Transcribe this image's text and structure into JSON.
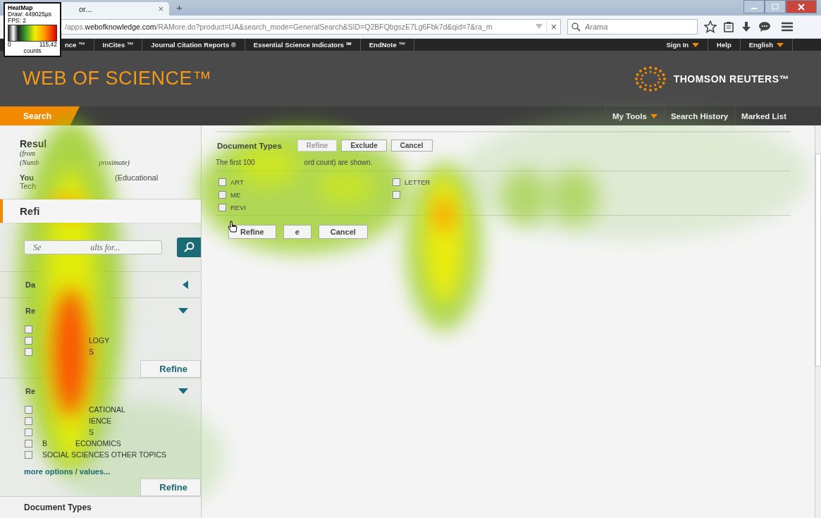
{
  "heatmap_legend": {
    "title": "HeatMap",
    "draw": "Draw: 449025µs",
    "fps": "FPS: 2",
    "min": "0",
    "max": "115,42",
    "unit": "counts"
  },
  "browser": {
    "tab": {
      "title": "or...",
      "close": "×"
    },
    "new_tab": "+",
    "url": "/apps.**webofknowledge.com**/RAMore.do?product=UA&search_mode=GeneralSearch&SID=Q2BFQbgszE7Lg6Fbk7d&qid=7&ra_m",
    "url_clear": "×",
    "search_placeholder": "Arama"
  },
  "top_nav": {
    "links": [
      "nce ™",
      "InCites ™",
      "Journal Citation Reports ®",
      "Essential Science Indicators ℠",
      "EndNote ™"
    ],
    "right": [
      {
        "label": "Sign In",
        "dropdown": true
      },
      {
        "label": "Help",
        "dropdown": false
      },
      {
        "label": "English",
        "dropdown": true
      }
    ]
  },
  "header": {
    "logo": "WEB OF SCIENCE™",
    "brand": "THOMSON REUTERS™"
  },
  "nav": {
    "search_tab": "Search",
    "right": [
      {
        "label": "My Tools",
        "dropdown": true
      },
      {
        "label": "Search History",
        "dropdown": false
      },
      {
        "label": "Marked List",
        "dropdown": false
      }
    ]
  },
  "sidebar": {
    "results": {
      "title": "Resul",
      "from": "(from",
      "note": [
        "(Numb",
        "proximate)"
      ],
      "query": [
        "You",
        "(Educational"
      ],
      "query_cont": "Tech"
    },
    "refine_heading": "Refi",
    "search_field": [
      "Se",
      "ults for..."
    ],
    "panels": [
      {
        "title": "Da",
        "expanded": false
      },
      {
        "title": "Re",
        "expanded": true,
        "rows": [
          {
            "checked": false
          },
          {
            "label": "LOGY",
            "kind": "tail",
            "checked": false
          },
          {
            "label": "S",
            "kind": "tail",
            "checked": false
          }
        ],
        "button": "Refine"
      },
      {
        "title": "Re",
        "expanded": true,
        "rows": [
          {
            "label": "CATIONAL",
            "kind": "tail",
            "checked": false
          },
          {
            "label": "IENCE",
            "kind": "tail",
            "checked": false
          },
          {
            "label": "S",
            "kind": "tail",
            "checked": false
          },
          {
            "parts": [
              "B",
              "ECONOMICS"
            ],
            "kind": "split",
            "checked": false
          },
          {
            "label": "SOCIAL SCIENCES OTHER TOPICS",
            "kind": "full",
            "checked": false
          }
        ],
        "more": "more options / values...",
        "button": "Refine"
      }
    ],
    "next_panel": "Document Types"
  },
  "main": {
    "title": "Document Types",
    "buttons": [
      {
        "label": "Refine",
        "disabled": true
      },
      {
        "label": "Exclude",
        "disabled": false
      },
      {
        "label": "Cancel",
        "disabled": false
      }
    ],
    "info": [
      "The first 100",
      "ord count) are shown."
    ],
    "columns": [
      [
        {
          "label": "ART",
          "checked": false
        },
        {
          "label": "ME",
          "checked": false
        },
        {
          "label": "REVI",
          "checked": false
        }
      ],
      [
        {
          "label": "LETTER",
          "checked": false
        },
        {
          "checked": false
        }
      ]
    ],
    "bottom_buttons": [
      {
        "label": "Refine",
        "disabled": false
      },
      {
        "label": "e",
        "disabled": false
      },
      {
        "label": "Cancel",
        "disabled": false
      }
    ]
  }
}
